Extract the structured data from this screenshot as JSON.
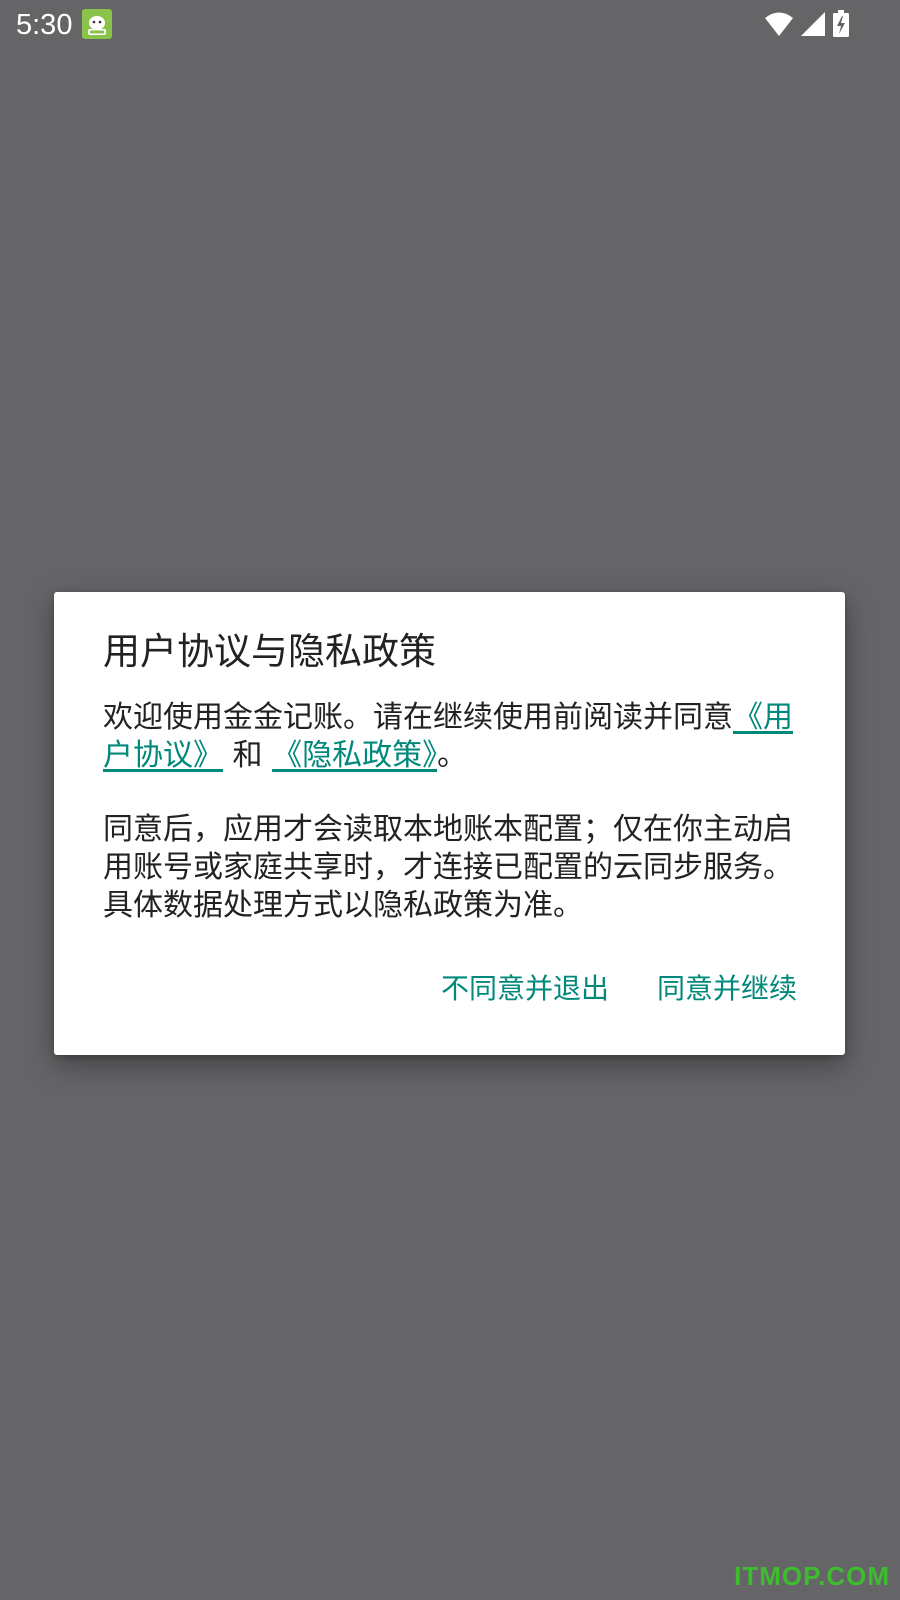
{
  "status_bar": {
    "time": "5:30",
    "icons": [
      "app-notification-icon",
      "wifi-icon",
      "cellular-signal-icon",
      "battery-charging-icon"
    ]
  },
  "dialog": {
    "title": "用户协议与隐私政策",
    "para1_prefix": "欢迎使用金金记账。请在继续使用前阅读并同意",
    "link_user_agreement": "《用户协议》",
    "para1_and": " 和 ",
    "link_privacy_policy": "《隐私政策》",
    "para1_suffix": "。",
    "para2": "同意后，应用才会读取本地账本配置；仅在你主动启用账号或家庭共享时，才连接已配置的云同步服务。具体数据处理方式以隐私政策为准。",
    "disagree_button": "不同意并退出",
    "agree_button": "同意并继续"
  },
  "watermark": "ITMOP.COM",
  "colors": {
    "accent": "#00897b",
    "scrim": "#656568",
    "dialog_bg": "#ffffff",
    "watermark": "#3dbd2e"
  }
}
